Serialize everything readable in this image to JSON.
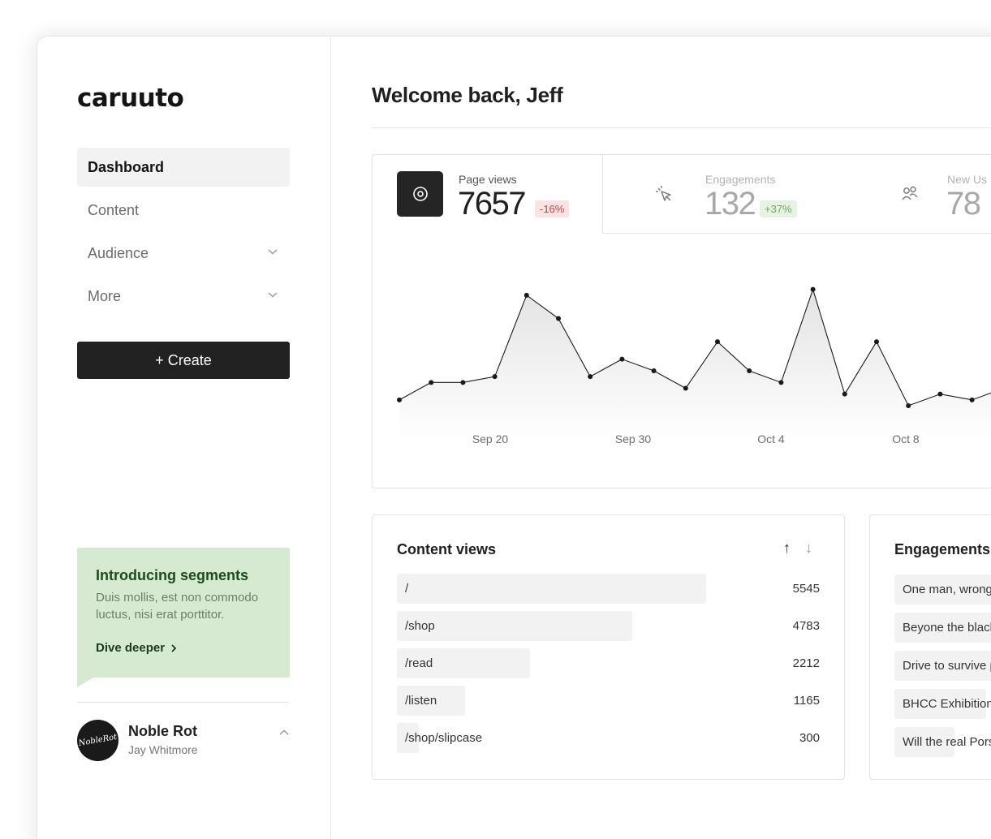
{
  "brand": {
    "logo": "caruuto"
  },
  "sidebar": {
    "items": [
      {
        "label": "Dashboard"
      },
      {
        "label": "Content"
      },
      {
        "label": "Audience"
      },
      {
        "label": "More"
      }
    ],
    "create_label": "+ Create",
    "promo": {
      "title": "Introducing segments",
      "text": "Duis mollis, est non commodo luctus, nisi erat porttitor.",
      "link": "Dive deeper"
    },
    "user": {
      "avatar_text": "NobleRot",
      "name": "Noble Rot",
      "subtitle": "Jay Whitmore"
    }
  },
  "header": {
    "welcome": "Welcome back, Jeff"
  },
  "metrics": [
    {
      "label": "Page views",
      "value": "7657",
      "change": "-16%",
      "icon": "eye-icon"
    },
    {
      "label": "Engagements",
      "value": "132",
      "change": "+37%",
      "icon": "cursor-click-icon"
    },
    {
      "label": "New Us",
      "value": "78",
      "icon": "users-icon"
    }
  ],
  "chart_data": {
    "type": "area",
    "x_ticks": [
      "Sep 20",
      "Sep 30",
      "Oct 4",
      "Oct 8"
    ],
    "values": [
      7,
      10,
      10,
      11,
      25,
      21,
      11,
      14,
      12,
      9,
      17,
      12,
      10,
      26,
      8,
      17,
      6,
      8,
      7,
      9
    ],
    "ylim": [
      0,
      30
    ],
    "grid": false,
    "line_color": "#1a1a1a",
    "fill_color": "#ececec"
  },
  "content_views": {
    "title": "Content views",
    "sort_up": "↑",
    "sort_down": "↓",
    "rows": [
      {
        "path": "/",
        "views": "5545",
        "share": 1.0
      },
      {
        "path": "/shop",
        "views": "4783",
        "share": 0.76
      },
      {
        "path": "/read",
        "views": "2212",
        "share": 0.43
      },
      {
        "path": "/listen",
        "views": "1165",
        "share": 0.22
      },
      {
        "path": "/shop/slipcase",
        "views": "300",
        "share": 0.07
      }
    ]
  },
  "engagements": {
    "title": "Engagements",
    "rows": [
      {
        "label": "One man, wrong"
      },
      {
        "label": "Beyone the black"
      },
      {
        "label": "Drive to survive p"
      },
      {
        "label": "BHCC Exhibition"
      },
      {
        "label": "Will the real Pors"
      }
    ]
  }
}
